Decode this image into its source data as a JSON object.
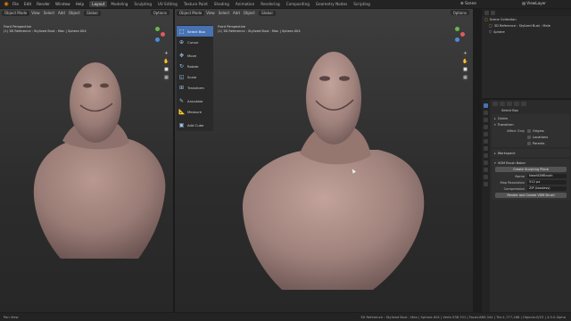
{
  "topbar": {
    "menus": [
      "File",
      "Edit",
      "Render",
      "Window",
      "Help"
    ],
    "workspaces": [
      "Layout",
      "Modeling",
      "Sculpting",
      "UV Editing",
      "Texture Paint",
      "Shading",
      "Animation",
      "Rendering",
      "Compositing",
      "Geometry Nodes",
      "Scripting"
    ],
    "active_workspace": "Layout",
    "scene_label": "Scene",
    "view_layer_label": "ViewLayer"
  },
  "viewport_left": {
    "mode": "Object Mode",
    "menus": [
      "View",
      "Select",
      "Add",
      "Object"
    ],
    "orientation": "Global",
    "options": "Options",
    "view_name": "Front Perspective",
    "object_info": "(1) 3D Reference : Stylized Bust : Man | Sphere.004"
  },
  "viewport_right": {
    "mode": "Object Mode",
    "menus": [
      "View",
      "Select",
      "Add",
      "Object"
    ],
    "orientation": "Global",
    "options": "Options",
    "view_name": "Front Perspective",
    "object_info": "(1) 3D Reference : Stylized Bust : Man | Sphere.004"
  },
  "tools": [
    {
      "label": "Select Box",
      "icon": "select-box-icon",
      "active": true
    },
    {
      "label": "Cursor",
      "icon": "cursor-icon",
      "active": false
    },
    {
      "label": "Move",
      "icon": "move-icon",
      "active": false
    },
    {
      "label": "Rotate",
      "icon": "rotate-icon",
      "active": false
    },
    {
      "label": "Scale",
      "icon": "scale-icon",
      "active": false
    },
    {
      "label": "Transform",
      "icon": "transform-icon",
      "active": false
    },
    {
      "label": "Annotate",
      "icon": "annotate-icon",
      "active": false
    },
    {
      "label": "Measure",
      "icon": "measure-icon",
      "active": false
    },
    {
      "label": "Add Cube",
      "icon": "add-cube-icon",
      "active": false
    }
  ],
  "outliner": {
    "rows": [
      {
        "label": "Scene Collection",
        "type": "collection"
      },
      {
        "label": "3D Reference : Stylized Bust : Male",
        "type": "collection"
      },
      {
        "label": "Sphere",
        "type": "object"
      }
    ]
  },
  "properties": {
    "tool_name": "Select Box",
    "colors_panel": "Colors",
    "transform_panel": "Transform",
    "affect_only_label": "Affect Only",
    "affect_only_options": [
      "Origins",
      "Locations",
      "Parents"
    ],
    "workspace_panel": "Workspace",
    "baker_panel": "VDM Brush Baker",
    "create_plane_button": "Create Sculpting Plane",
    "name_label": "Name",
    "name_value": "NewVDMBrush",
    "resolution_label": "Map Resolution",
    "resolution_value": "512 px",
    "compression_label": "Compression",
    "compression_value": "ZIP (lossless)",
    "render_button": "Render and Create VDM Brush"
  },
  "statusbar": {
    "left": "Pan View",
    "right": "3D Reference : Stylized Bust : Man | Sphere.004 | Verts:338,701 | Faces:889,344 | Tris:1,777,188 | Objects:0/23 | 4.0.0 Alpha"
  },
  "colors": {
    "accent": "#4772b3",
    "blender_orange": "#e87d0d",
    "clay": "#a98a84"
  }
}
